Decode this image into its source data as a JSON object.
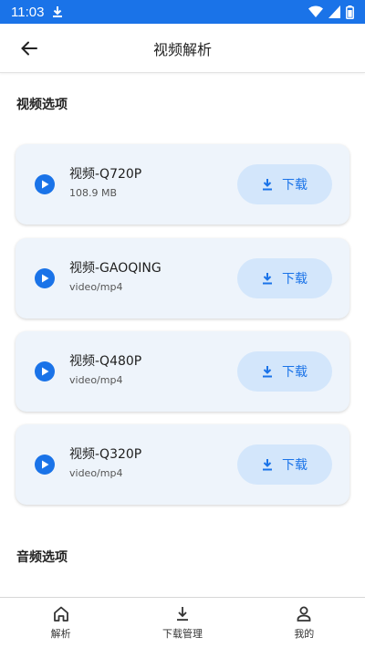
{
  "status_bar": {
    "time": "11:03"
  },
  "app_bar": {
    "title": "视频解析"
  },
  "sections": {
    "video_title": "视频选项",
    "audio_title": "音频选项"
  },
  "video_options": [
    {
      "name": "视频-Q720P",
      "sub": "108.9 MB",
      "button": "下载"
    },
    {
      "name": "视频-GAOQING",
      "sub": "video/mp4",
      "button": "下载"
    },
    {
      "name": "视频-Q480P",
      "sub": "video/mp4",
      "button": "下载"
    },
    {
      "name": "视频-Q320P",
      "sub": "video/mp4",
      "button": "下载"
    }
  ],
  "bottom_nav": {
    "items": [
      {
        "label": "解析",
        "icon": "home-icon"
      },
      {
        "label": "下载管理",
        "icon": "download-icon"
      },
      {
        "label": "我的",
        "icon": "person-icon"
      }
    ]
  },
  "colors": {
    "accent": "#1a73e8",
    "card_bg": "#eef4fb",
    "button_bg": "#d3e6fb"
  }
}
